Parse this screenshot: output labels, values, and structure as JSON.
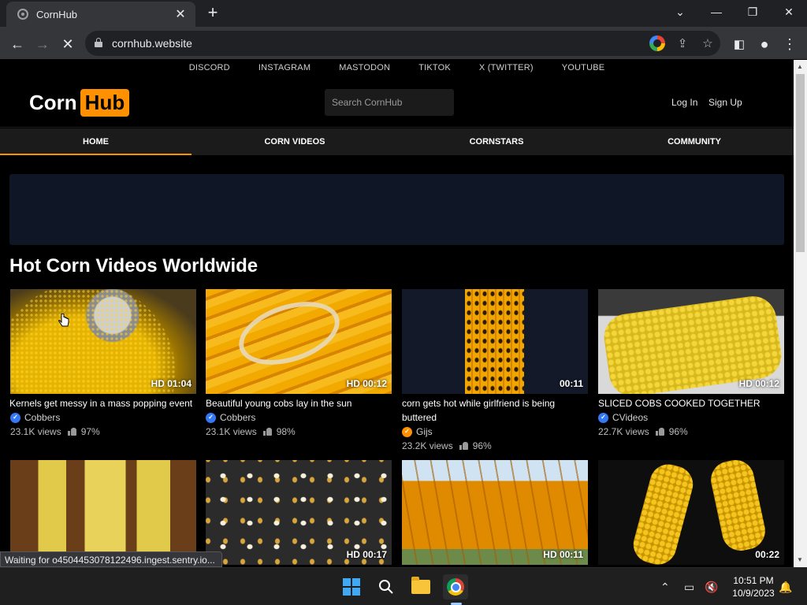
{
  "browser": {
    "tab_title": "CornHub",
    "url": "cornhub.website",
    "status_text": "Waiting for o4504453078122496.ingest.sentry.io..."
  },
  "site": {
    "social_links": [
      "DISCORD",
      "INSTAGRAM",
      "MASTODON",
      "TIKTOK",
      "X (TWITTER)",
      "YOUTUBE"
    ],
    "logo_part1": "Corn",
    "logo_part2": "Hub",
    "search_placeholder": "Search CornHub",
    "login": "Log In",
    "signup": "Sign Up",
    "nav": [
      "HOME",
      "CORN VIDEOS",
      "CORNSTARS",
      "COMMUNITY"
    ],
    "section_title": "Hot Corn Videos Worldwide",
    "accent_color": "#ff9000"
  },
  "videos": [
    {
      "title": "Kernels get messy in a mass popping event",
      "channel": "Cobbers",
      "badge": "blue",
      "views": "23.1K views",
      "rating": "97%",
      "duration": "HD 01:04"
    },
    {
      "title": "Beautiful young cobs lay in the sun",
      "channel": "Cobbers",
      "badge": "blue",
      "views": "23.1K views",
      "rating": "98%",
      "duration": "HD 00:12"
    },
    {
      "title": "corn gets hot while girlfriend is being buttered",
      "channel": "Gijs",
      "badge": "orange",
      "views": "23.2K views",
      "rating": "96%",
      "duration": "00:11"
    },
    {
      "title": "SLICED COBS COOKED TOGETHER",
      "channel": "CVideos",
      "badge": "blue",
      "views": "22.7K views",
      "rating": "96%",
      "duration": "HD 00:12"
    },
    {
      "duration": ""
    },
    {
      "duration": "HD 00:17"
    },
    {
      "duration": "HD 00:11"
    },
    {
      "duration": "00:22"
    }
  ],
  "taskbar": {
    "time": "10:51 PM",
    "date": "10/9/2023"
  }
}
